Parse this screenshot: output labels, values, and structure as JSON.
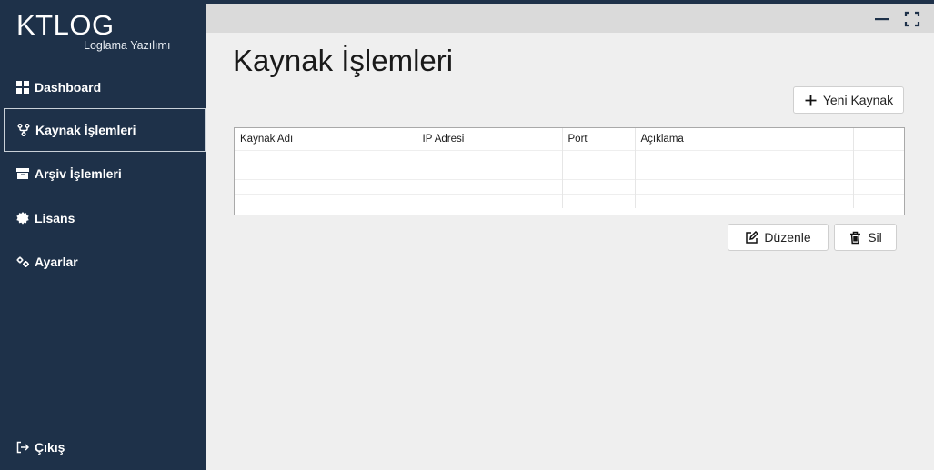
{
  "brand": {
    "title": "KTLOG",
    "subtitle": "Loglama Yazılımı"
  },
  "sidebar": {
    "items": [
      {
        "label": "Dashboard",
        "icon": "dashboard-icon"
      },
      {
        "label": "Kaynak İşlemleri",
        "icon": "fork-icon",
        "active": true
      },
      {
        "label": "Arşiv İşlemleri",
        "icon": "archive-icon"
      },
      {
        "label": "Lisans",
        "icon": "certificate-icon"
      },
      {
        "label": "Ayarlar",
        "icon": "gears-icon"
      }
    ],
    "logout": {
      "label": "Çıkış",
      "icon": "sign-out-icon"
    }
  },
  "page": {
    "title": "Kaynak İşlemleri"
  },
  "actions": {
    "new_label": "Yeni Kaynak",
    "edit_label": "Düzenle",
    "delete_label": "Sil"
  },
  "table": {
    "columns": [
      "Kaynak Adı",
      "IP Adresi",
      "Port",
      "Açıklama",
      ""
    ],
    "rows": []
  },
  "colors": {
    "sidebar_bg": "#1e3149",
    "content_bg": "#efefef",
    "titlebar_bg": "#dadada"
  }
}
